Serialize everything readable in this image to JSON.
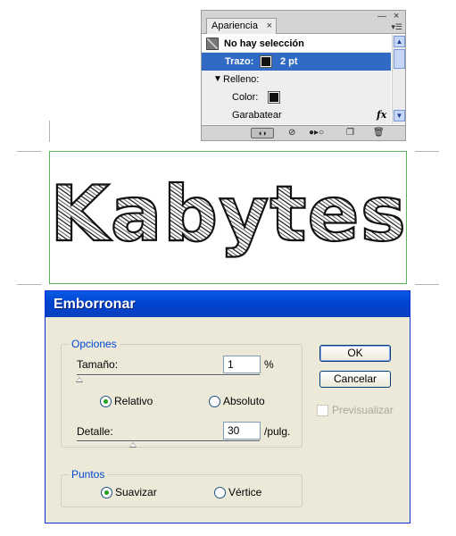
{
  "appearance_panel": {
    "tab_label": "Apariencia",
    "tab_close": "×",
    "minimize_glyph": "—",
    "close_glyph": "×",
    "menu_glyph": "▾☰",
    "object_label": "No hay selección",
    "stroke_label": "Trazo:",
    "stroke_value": "2 pt",
    "fill_label": "Relleno:",
    "color_label": "Color:",
    "effect_label": "Garabatear",
    "fx_label": "fx",
    "scroll_up": "▲",
    "scroll_down": "▼",
    "footer_icons": [
      "new-art-basic-appearance-icon",
      "clear-appearance-icon",
      "reduce-to-basic-appearance-icon",
      "duplicate-item-icon",
      "delete-item-icon"
    ]
  },
  "artboard": {
    "text": "Kabytes",
    "border_color": "#5ab45a"
  },
  "dialog": {
    "title": "Emborronar",
    "options_group": {
      "legend": "Opciones",
      "size_label": "Tamaño:",
      "size_value": "1",
      "size_unit": "%",
      "relative_label": "Relativo",
      "absolute_label": "Absoluto",
      "detail_label": "Detalle:",
      "detail_value": "30",
      "detail_unit": "/pulg."
    },
    "points_group": {
      "legend": "Puntos",
      "smooth_label": "Suavizar",
      "corner_label": "Vértice"
    },
    "ok_label": "OK",
    "cancel_label": "Cancelar",
    "preview_label": "Previsualizar",
    "selected_mode": "Relativo",
    "selected_points": "Suavizar"
  },
  "colors": {
    "title_bar": "#0044cf",
    "selection": "#316ac5",
    "group_legend": "#0046d5",
    "radio_dot": "#21a121"
  }
}
